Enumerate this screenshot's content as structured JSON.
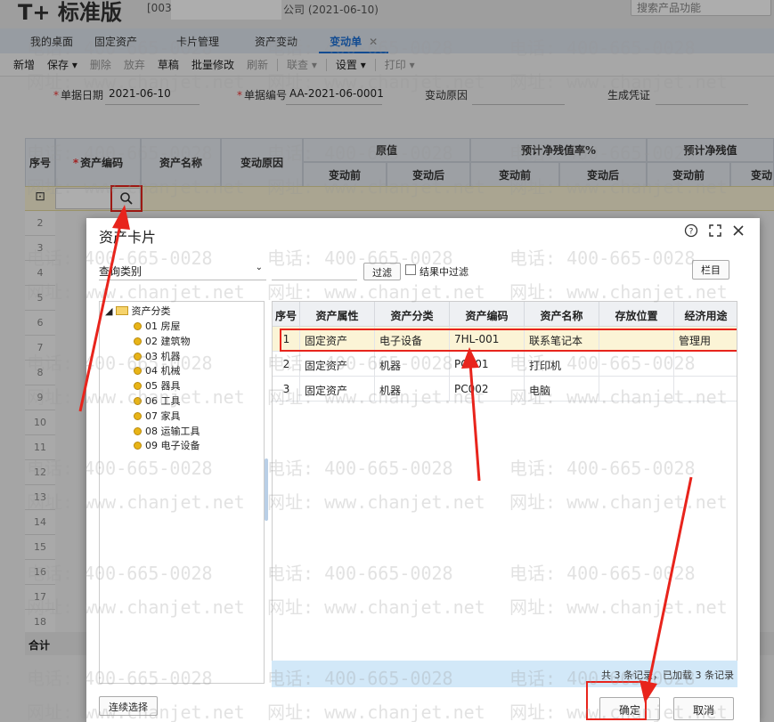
{
  "app": {
    "brand": "标准版",
    "company_code": "[003]",
    "company_suffix": "公司",
    "company_date": "(2021-06-10)",
    "search_placeholder": "搜索产品功能"
  },
  "nav_tabs": [
    {
      "label": "我的桌面"
    },
    {
      "label": "固定资产"
    },
    {
      "label": "卡片管理"
    },
    {
      "label": "资产变动"
    },
    {
      "label": "变动单",
      "close": "✕"
    }
  ],
  "toolbar": {
    "new": "新增",
    "save": "保存",
    "delete": "删除",
    "abandon": "放弃",
    "draft": "草稿",
    "batch_edit": "批量修改",
    "refresh": "刷新",
    "linked": "联查",
    "settings": "设置",
    "print": "打印"
  },
  "form": {
    "doc_date_label": "单据日期",
    "doc_date_value": "2021-06-10",
    "doc_no_label": "单据编号",
    "doc_no_value": "AA-2021-06-0001",
    "reason_label": "变动原因",
    "voucher_label": "生成凭证"
  },
  "grid": {
    "headers": {
      "seq": "序号",
      "asset_code": "资产编码",
      "asset_name": "资产名称",
      "change_reason": "变动原因",
      "orig_value": "原值",
      "net_rate": "预计净残值率%",
      "net_value": "预计净残值",
      "before": "变动前",
      "after": "变动后",
      "before2": "变动前",
      "after2": "变动后",
      "before3": "变动前",
      "cut3": "变动"
    },
    "row_numbers": [
      "2",
      "3",
      "4",
      "5",
      "6",
      "7",
      "8",
      "9",
      "10",
      "11",
      "12",
      "13",
      "14",
      "15",
      "16",
      "17",
      "18"
    ],
    "total_label": "合计"
  },
  "modal": {
    "title": "资产卡片",
    "help_icon": "?",
    "filter_select": "查询类别",
    "filter_button": "过滤",
    "filter_in_result": "结果中过滤",
    "columns_button": "栏目",
    "tree_root": "资产分类",
    "tree_items": [
      "01 房屋",
      "02 建筑物",
      "03 机器",
      "04 机械",
      "05 器具",
      "06 工具",
      "07 家具",
      "08 运输工具",
      "09 电子设备"
    ],
    "table_headers": [
      "序号",
      "资产属性",
      "资产分类",
      "资产编码",
      "资产名称",
      "存放位置",
      "经济用途"
    ],
    "rows": [
      [
        "1",
        "固定资产",
        "电子设备",
        "7HL-001",
        "联系笔记本",
        "",
        "管理用"
      ],
      [
        "2",
        "固定资产",
        "机器",
        "PC001",
        "打印机",
        "",
        ""
      ],
      [
        "3",
        "固定资产",
        "机器",
        "PC002",
        "电脑",
        "",
        ""
      ]
    ],
    "footer_status": "共 3 条记录，已加载 3 条记录",
    "continuous_select": "连续选择",
    "ok": "确定",
    "cancel": "取消"
  },
  "watermark": {
    "phone": "电话: 400-665-0028",
    "site": "网址: www.chanjet.net"
  }
}
